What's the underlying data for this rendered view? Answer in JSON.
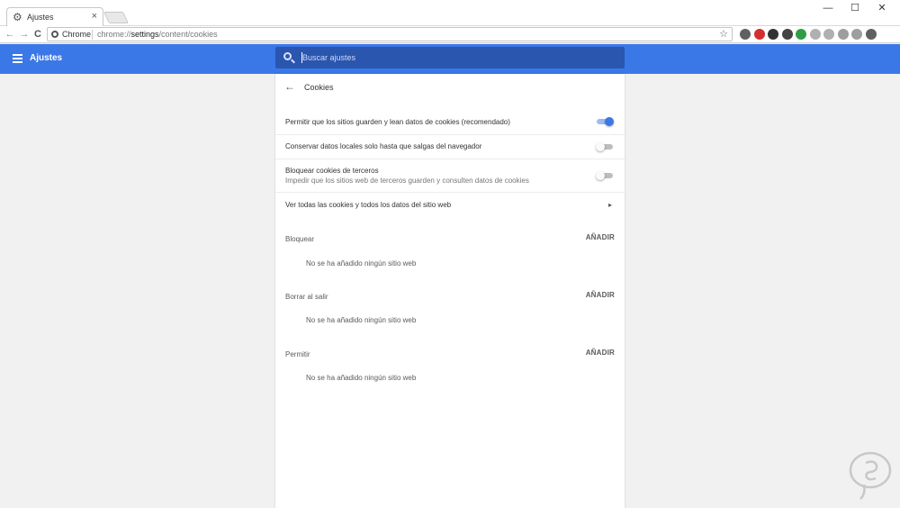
{
  "browser": {
    "tab_title": "Ajustes",
    "tab_close": "×",
    "window_controls": {
      "minimize": "—",
      "maximize": "☐",
      "close": "✕"
    },
    "nav": {
      "back": "←",
      "forward": "→",
      "reload": "C"
    },
    "omnibox": {
      "scheme_label": "Chrome",
      "url_prefix": "chrome://",
      "url_main": "settings",
      "url_rest": "/content/cookies",
      "bookmark_star": "☆"
    },
    "extension_colors": [
      "#606060",
      "#d32f2f",
      "#333333",
      "#444444",
      "#2e9e46",
      "#b0b0b0",
      "#b0b0b0",
      "#9e9e9e",
      "#9e9e9e",
      "#606060"
    ]
  },
  "header": {
    "title": "Ajustes",
    "search_placeholder": "Buscar ajustes"
  },
  "colors": {
    "brand_blue": "#3b78e7",
    "search_bg": "#2a56b0",
    "toggle_on": "#3b78e7"
  },
  "page": {
    "back_icon": "←",
    "title": "Cookies",
    "settings": [
      {
        "label": "Permitir que los sitios guarden y lean datos de cookies (recomendado)",
        "toggle": true
      },
      {
        "label": "Conservar datos locales solo hasta que salgas del navegador",
        "toggle": false
      },
      {
        "label": "Bloquear cookies de terceros",
        "sub": "Impedir que los sitios web de terceros guarden y consulten datos de cookies",
        "toggle": false
      },
      {
        "label": "Ver todas las cookies y todos los datos del sitio web",
        "chevron": "▸"
      }
    ],
    "sections": [
      {
        "title": "Bloquear",
        "add_label": "AÑADIR",
        "empty_text": "No se ha añadido ningún sitio web"
      },
      {
        "title": "Borrar al salir",
        "add_label": "AÑADIR",
        "empty_text": "No se ha añadido ningún sitio web"
      },
      {
        "title": "Permitir",
        "add_label": "AÑADIR",
        "empty_text": "No se ha añadido ningún sitio web"
      }
    ]
  }
}
